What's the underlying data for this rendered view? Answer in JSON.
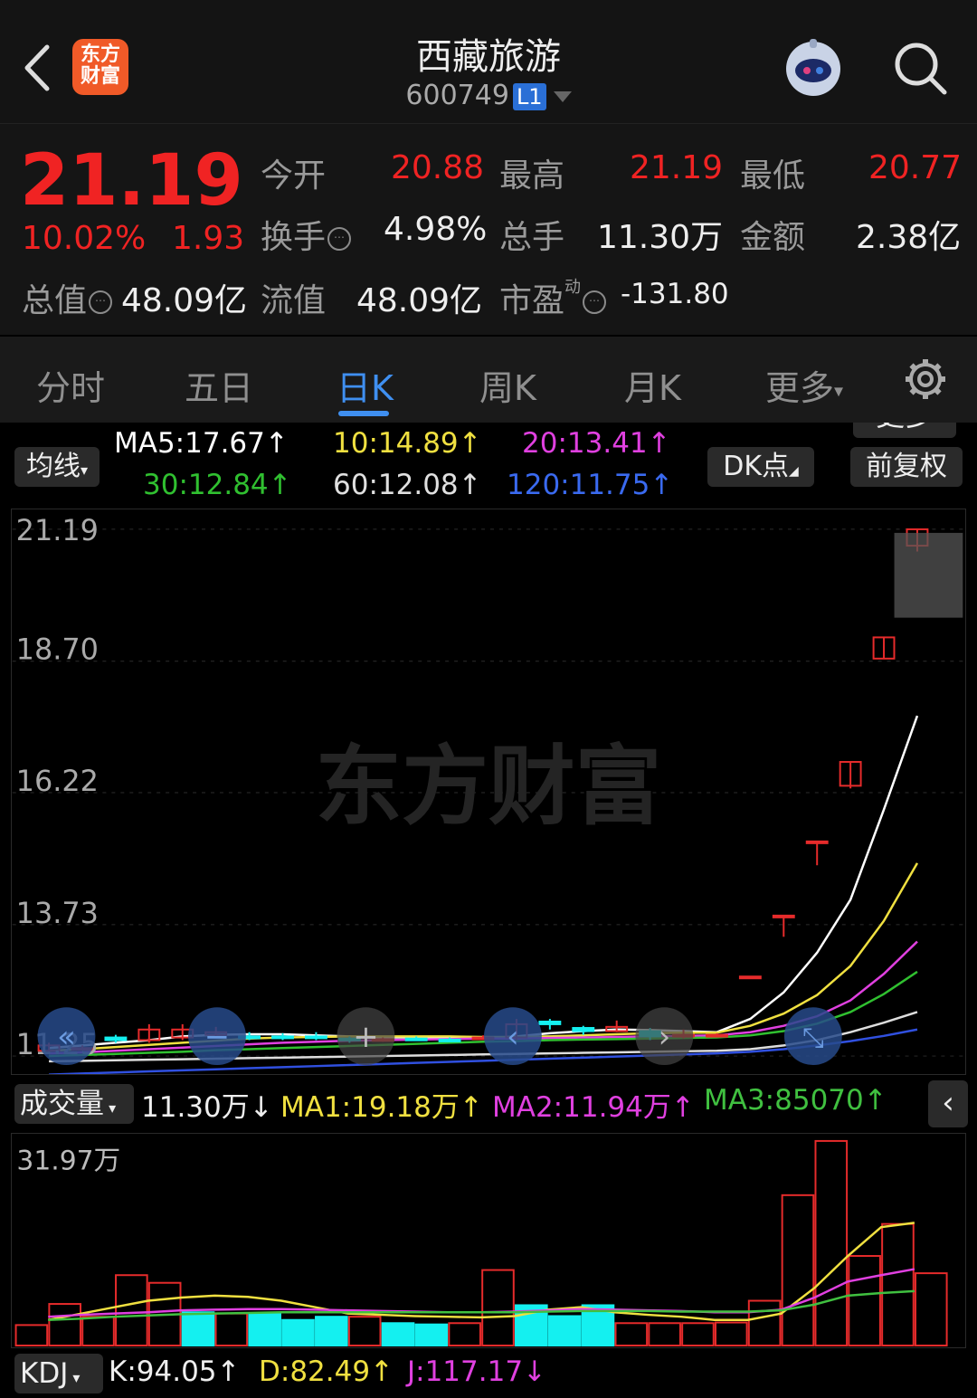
{
  "header": {
    "title": "西藏旅游",
    "code": "600749",
    "level_badge": "L1",
    "logo_text_1": "东方",
    "logo_text_2": "财富"
  },
  "quote": {
    "price": "21.19",
    "change_pct": "10.02%",
    "change": "1.93",
    "open_label": "今开",
    "open": "20.88",
    "high_label": "最高",
    "high": "21.19",
    "low_label": "最低",
    "low": "20.77",
    "turnover_label": "换手",
    "turnover": "4.98%",
    "volume_label": "总手",
    "volume": "11.30万",
    "amount_label": "金额",
    "amount": "2.38亿",
    "mktcap_label": "总值",
    "mktcap": "48.09亿",
    "float_label": "流值",
    "float_cap": "48.09亿",
    "pe_label": "市盈",
    "pe_sup": "动",
    "pe": "-131.80",
    "more": "更多"
  },
  "tabs": [
    "分时",
    "五日",
    "日K",
    "周K",
    "月K",
    "更多"
  ],
  "active_tab": "日K",
  "ma_controls": {
    "ma_btn": "均线",
    "dk_btn": "DK点",
    "adjust_btn": "前复权",
    "ma5": "MA5:17.67↑",
    "ma10": "10:14.89↑",
    "ma20": "20:13.41↑",
    "ma30": "30:12.84↑",
    "ma60": "60:12.08↑",
    "ma120": "120:11.75↑"
  },
  "chart_data": {
    "type": "candlestick",
    "y_ticks": [
      "21.19",
      "18.70",
      "16.22",
      "13.73",
      "11.25"
    ],
    "ylim": [
      11.25,
      21.19
    ],
    "watermark": "东方财富",
    "candles": [
      {
        "o": 11.35,
        "c": 11.45,
        "h": 11.5,
        "l": 11.3,
        "up": true
      },
      {
        "o": 11.4,
        "c": 11.4,
        "h": 11.45,
        "l": 11.35,
        "up": true
      },
      {
        "o": 11.6,
        "c": 11.55,
        "h": 11.65,
        "l": 11.5,
        "up": false
      },
      {
        "o": 11.55,
        "c": 11.75,
        "h": 11.85,
        "l": 11.5,
        "up": true
      },
      {
        "o": 11.6,
        "c": 11.75,
        "h": 11.85,
        "l": 11.55,
        "up": true
      },
      {
        "o": 11.65,
        "c": 11.7,
        "h": 11.8,
        "l": 11.6,
        "up": true
      },
      {
        "o": 11.62,
        "c": 11.62,
        "h": 11.7,
        "l": 11.55,
        "up": false
      },
      {
        "o": 11.62,
        "c": 11.6,
        "h": 11.68,
        "l": 11.55,
        "up": false
      },
      {
        "o": 11.62,
        "c": 11.62,
        "h": 11.7,
        "l": 11.55,
        "up": false
      },
      {
        "o": 11.58,
        "c": 11.56,
        "h": 11.62,
        "l": 11.5,
        "up": false
      },
      {
        "o": 11.57,
        "c": 11.57,
        "h": 11.6,
        "l": 11.52,
        "up": true
      },
      {
        "o": 11.58,
        "c": 11.58,
        "h": 11.62,
        "l": 11.55,
        "up": false
      },
      {
        "o": 11.56,
        "c": 11.56,
        "h": 11.6,
        "l": 11.52,
        "up": false
      },
      {
        "o": 11.58,
        "c": 11.6,
        "h": 11.64,
        "l": 11.55,
        "up": true
      },
      {
        "o": 11.6,
        "c": 11.85,
        "h": 11.95,
        "l": 11.55,
        "up": true
      },
      {
        "o": 11.9,
        "c": 11.85,
        "h": 11.95,
        "l": 11.75,
        "up": false
      },
      {
        "o": 11.78,
        "c": 11.72,
        "h": 11.82,
        "l": 11.65,
        "up": false
      },
      {
        "o": 11.72,
        "c": 11.8,
        "h": 11.92,
        "l": 11.7,
        "up": true
      },
      {
        "o": 11.72,
        "c": 11.62,
        "h": 11.78,
        "l": 11.55,
        "up": false
      },
      {
        "o": 11.62,
        "c": 11.65,
        "h": 11.75,
        "l": 11.58,
        "up": true
      },
      {
        "o": 11.65,
        "c": 11.65,
        "h": 11.68,
        "l": 11.6,
        "up": true
      },
      {
        "o": 12.75,
        "c": 12.75,
        "h": 12.75,
        "l": 12.75,
        "up": true
      },
      {
        "o": 13.9,
        "c": 13.9,
        "h": 13.9,
        "l": 13.5,
        "up": true
      },
      {
        "o": 15.3,
        "c": 15.3,
        "h": 15.3,
        "l": 14.85,
        "up": true
      },
      {
        "o": 16.8,
        "c": 16.35,
        "h": 16.8,
        "l": 16.3,
        "up": true
      },
      {
        "o": 19.15,
        "c": 18.75,
        "h": 19.15,
        "l": 18.75,
        "up": true
      },
      {
        "o": 20.88,
        "c": 21.19,
        "h": 21.19,
        "l": 20.77,
        "up": true
      }
    ],
    "ma_lines": [
      {
        "name": "MA5",
        "color": "#ffffff",
        "values": [
          11.4,
          11.45,
          11.5,
          11.55,
          11.62,
          11.65,
          11.66,
          11.66,
          11.64,
          11.62,
          11.6,
          11.6,
          11.58,
          11.58,
          11.62,
          11.68,
          11.72,
          11.75,
          11.74,
          11.72,
          11.7,
          11.95,
          12.45,
          13.2,
          14.2,
          15.9,
          17.67
        ]
      },
      {
        "name": "MA10",
        "color": "#f0e040",
        "values": [
          11.35,
          11.38,
          11.42,
          11.46,
          11.5,
          11.54,
          11.58,
          11.6,
          11.61,
          11.62,
          11.62,
          11.62,
          11.62,
          11.61,
          11.61,
          11.62,
          11.64,
          11.66,
          11.68,
          11.69,
          11.69,
          11.82,
          12.05,
          12.4,
          12.95,
          13.8,
          14.89
        ]
      },
      {
        "name": "MA20",
        "color": "#e040e0",
        "values": [
          11.3,
          11.32,
          11.35,
          11.38,
          11.41,
          11.44,
          11.47,
          11.5,
          11.52,
          11.54,
          11.55,
          11.56,
          11.57,
          11.58,
          11.58,
          11.59,
          11.6,
          11.61,
          11.62,
          11.63,
          11.64,
          11.7,
          11.82,
          12.0,
          12.3,
          12.8,
          13.41
        ]
      },
      {
        "name": "MA30",
        "color": "#30c030",
        "values": [
          11.25,
          11.27,
          11.29,
          11.31,
          11.33,
          11.36,
          11.38,
          11.4,
          11.42,
          11.44,
          11.46,
          11.48,
          11.5,
          11.52,
          11.53,
          11.55,
          11.56,
          11.57,
          11.58,
          11.59,
          11.6,
          11.64,
          11.72,
          11.86,
          12.08,
          12.42,
          12.84
        ]
      },
      {
        "name": "MA60",
        "color": "#dddddd",
        "values": [
          11.15,
          11.16,
          11.17,
          11.18,
          11.19,
          11.2,
          11.21,
          11.22,
          11.23,
          11.24,
          11.25,
          11.26,
          11.27,
          11.28,
          11.29,
          11.3,
          11.31,
          11.32,
          11.33,
          11.34,
          11.35,
          11.38,
          11.45,
          11.55,
          11.7,
          11.88,
          12.08
        ]
      },
      {
        "name": "MA120",
        "color": "#3050e0",
        "values": [
          10.9,
          10.92,
          10.94,
          10.96,
          10.98,
          11.0,
          11.02,
          11.04,
          11.06,
          11.08,
          11.1,
          11.12,
          11.14,
          11.16,
          11.18,
          11.2,
          11.22,
          11.24,
          11.26,
          11.28,
          11.3,
          11.33,
          11.38,
          11.45,
          11.53,
          11.63,
          11.75
        ]
      }
    ],
    "volume": {
      "label": "成交量",
      "current": "11.30万↓",
      "ma1": "MA1:19.18万↑",
      "ma2": "MA2:11.94万↑",
      "ma3": "MA3:85070↑",
      "max_label": "31.97万",
      "ylim": [
        0,
        31.97
      ],
      "bars": [
        {
          "v": 3.2,
          "up": true
        },
        {
          "v": 6.5,
          "up": true
        },
        {
          "v": 4.5,
          "up": true
        },
        {
          "v": 11.0,
          "up": true
        },
        {
          "v": 9.8,
          "up": true
        },
        {
          "v": 5.2,
          "up": false
        },
        {
          "v": 5.0,
          "up": true
        },
        {
          "v": 5.0,
          "up": false
        },
        {
          "v": 4.0,
          "up": false
        },
        {
          "v": 4.5,
          "up": false
        },
        {
          "v": 4.5,
          "up": true
        },
        {
          "v": 3.5,
          "up": false
        },
        {
          "v": 3.3,
          "up": false
        },
        {
          "v": 3.5,
          "up": true
        },
        {
          "v": 11.8,
          "up": true
        },
        {
          "v": 6.3,
          "up": false
        },
        {
          "v": 4.6,
          "up": false
        },
        {
          "v": 6.3,
          "up": false
        },
        {
          "v": 3.5,
          "up": true
        },
        {
          "v": 3.5,
          "up": true
        },
        {
          "v": 3.5,
          "up": true
        },
        {
          "v": 3.6,
          "up": true
        },
        {
          "v": 7.0,
          "up": true
        },
        {
          "v": 23.5,
          "up": true
        },
        {
          "v": 31.97,
          "up": true
        },
        {
          "v": 14.0,
          "up": true
        },
        {
          "v": 19.0,
          "up": true
        },
        {
          "v": 11.3,
          "up": true
        }
      ],
      "ma_lines": [
        {
          "name": "MA1",
          "color": "#f0e040",
          "values": [
            4,
            5,
            6,
            7,
            7.5,
            7.8,
            7.6,
            7.0,
            6.0,
            5.0,
            4.8,
            4.6,
            4.5,
            4.4,
            4.6,
            5.6,
            6.0,
            5.2,
            4.8,
            4.5,
            4.0,
            4.0,
            5.0,
            9.0,
            14.0,
            18.5,
            19.18
          ]
        },
        {
          "name": "MA2",
          "color": "#e040e0",
          "values": [
            4.5,
            4.8,
            5.0,
            5.2,
            5.5,
            5.6,
            5.7,
            5.7,
            5.6,
            5.5,
            5.4,
            5.3,
            5.2,
            5.2,
            5.3,
            5.5,
            5.7,
            5.6,
            5.5,
            5.4,
            5.2,
            5.2,
            5.6,
            7.5,
            10.0,
            11.0,
            11.94
          ]
        },
        {
          "name": "MA3",
          "color": "#40c040",
          "values": [
            4.0,
            4.2,
            4.5,
            4.7,
            4.9,
            5.0,
            5.1,
            5.2,
            5.2,
            5.2,
            5.2,
            5.2,
            5.2,
            5.2,
            5.2,
            5.3,
            5.4,
            5.4,
            5.4,
            5.3,
            5.3,
            5.3,
            5.5,
            6.4,
            7.8,
            8.2,
            8.5
          ]
        }
      ]
    },
    "kdj": {
      "label": "KDJ",
      "k": "K:94.05↑",
      "d": "D:82.49↑",
      "j": "J:117.17↓"
    }
  },
  "colors": {
    "up": "#e62b2b",
    "down": "#14f0f0",
    "accent": "#3f8ff0"
  }
}
